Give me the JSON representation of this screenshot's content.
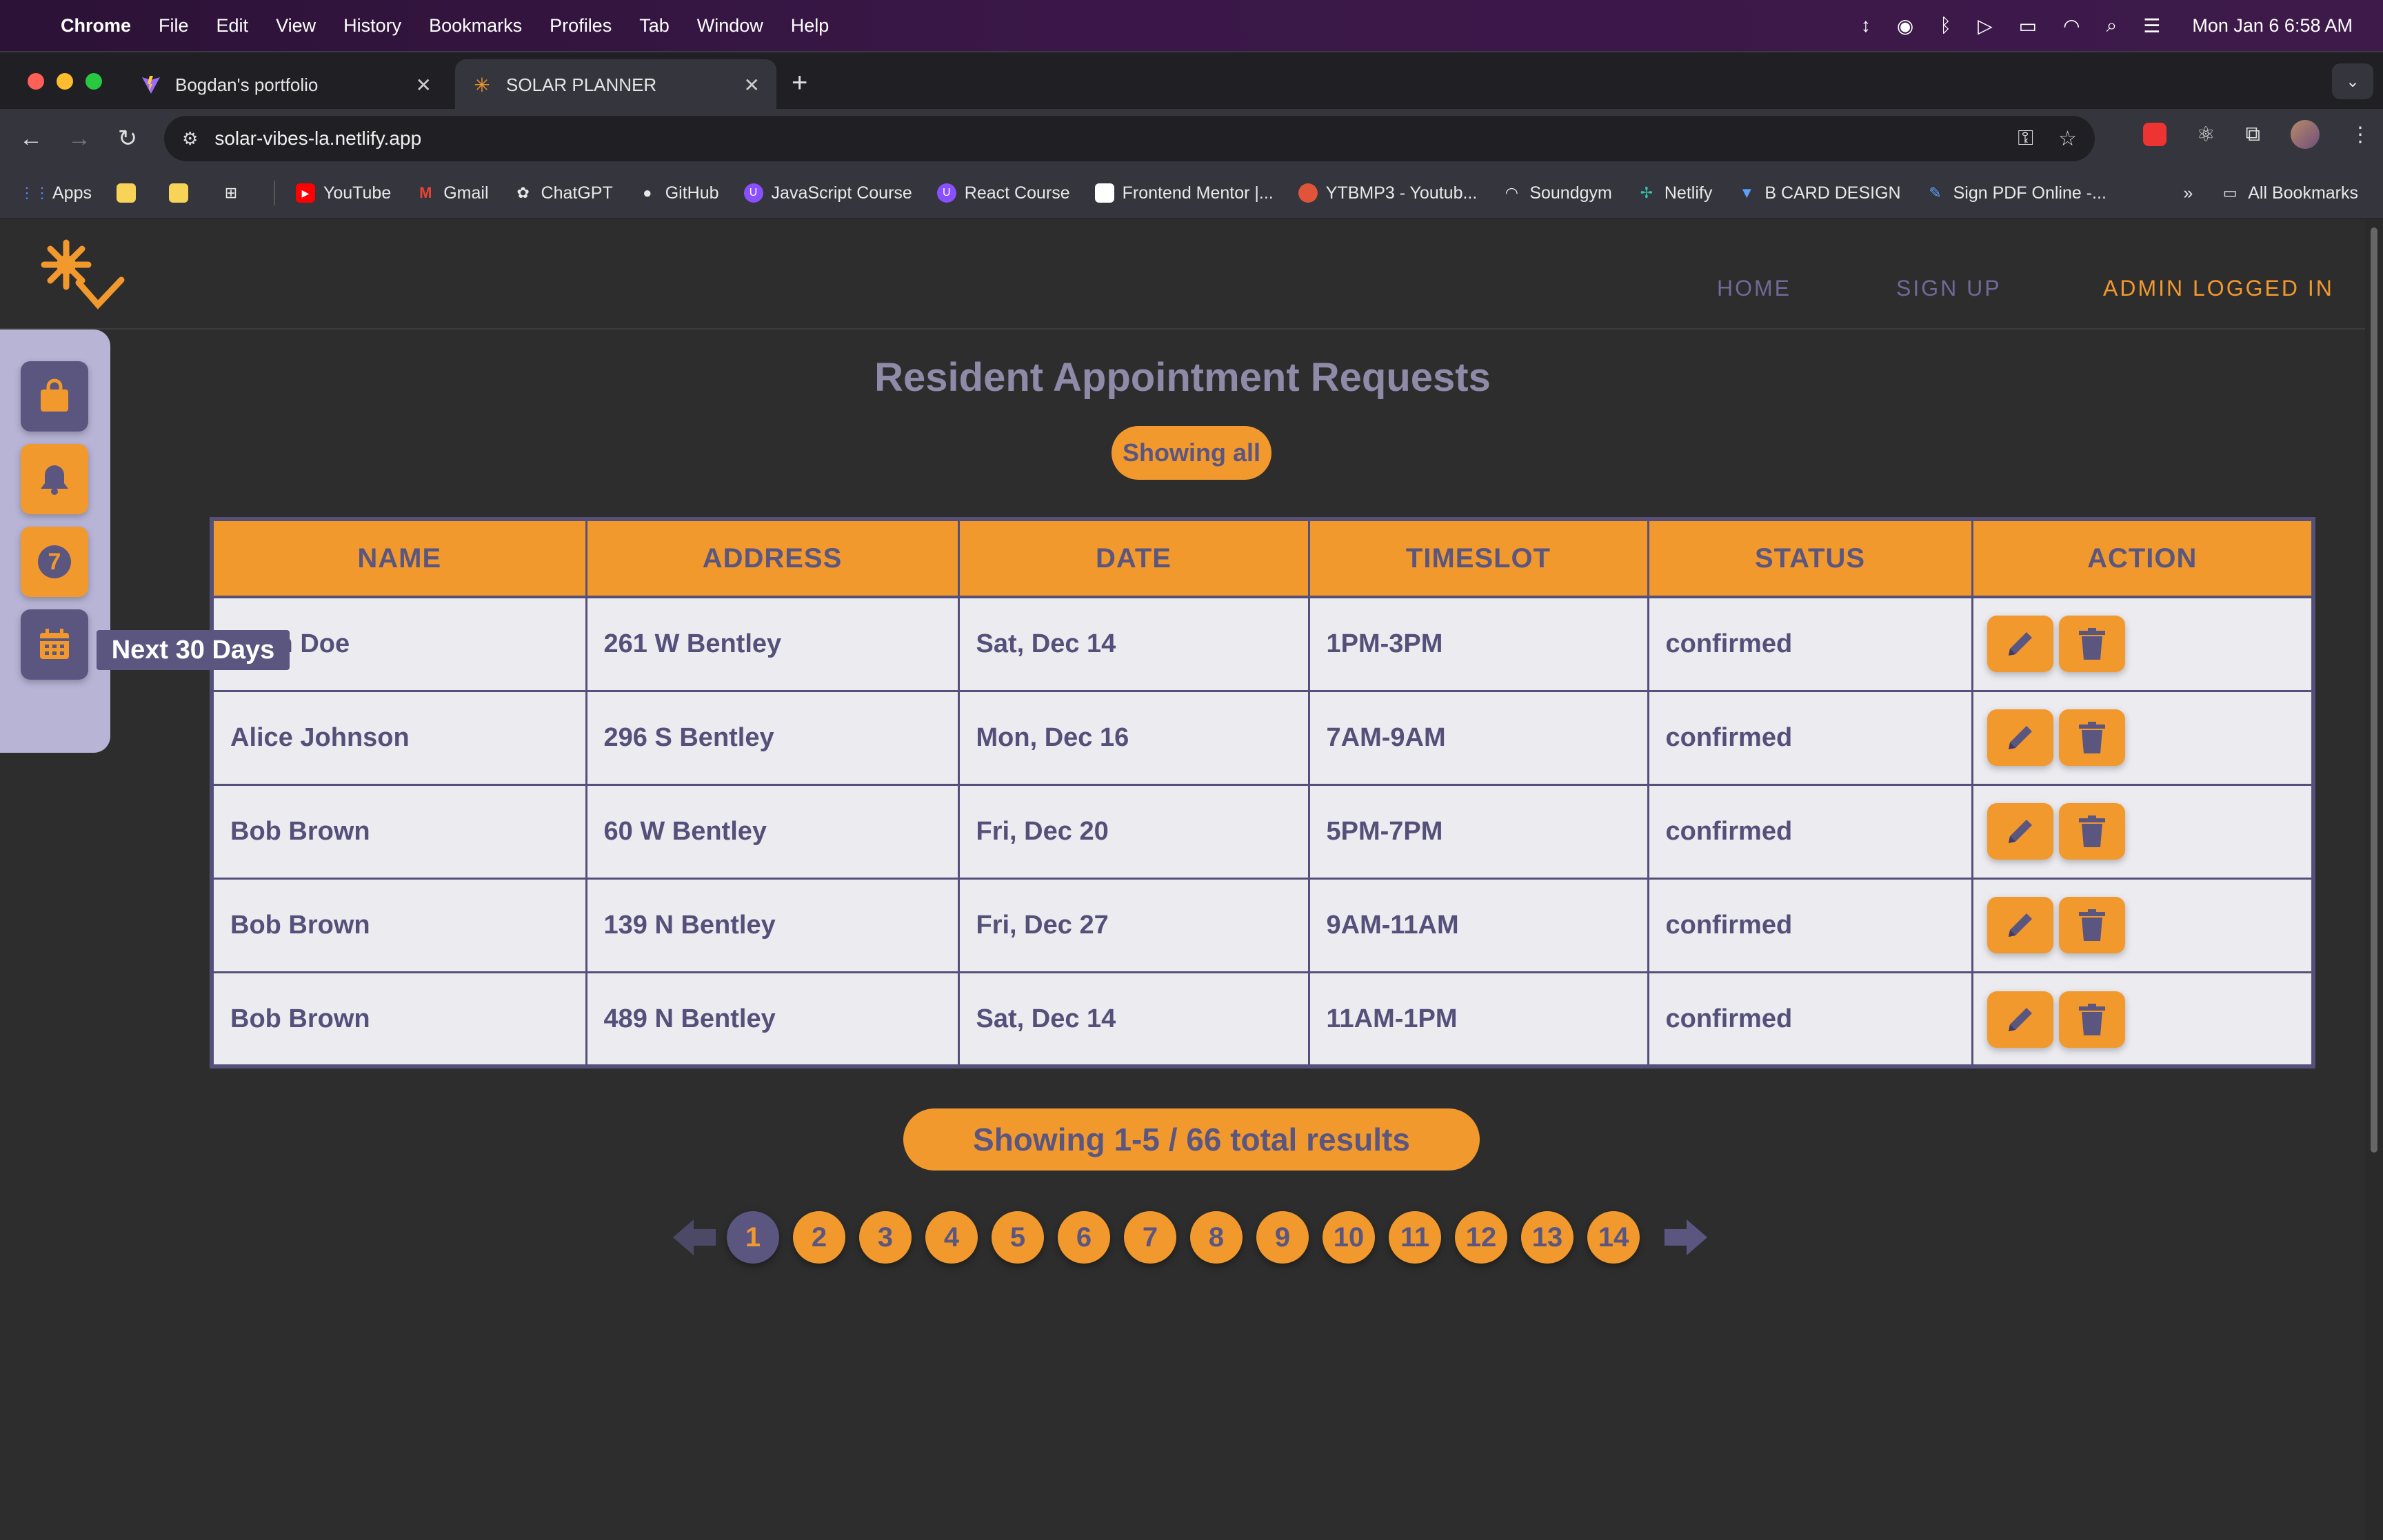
{
  "menubar": {
    "app": "Chrome",
    "items": [
      "File",
      "Edit",
      "View",
      "History",
      "Bookmarks",
      "Profiles",
      "Tab",
      "Window",
      "Help"
    ],
    "clock": "Mon Jan 6  6:58 AM"
  },
  "tabs": [
    {
      "title": "Bogdan's portfolio",
      "icon": "vite-logo-icon",
      "active": false
    },
    {
      "title": "SOLAR PLANNER",
      "icon": "sun-icon",
      "active": true
    }
  ],
  "omnibox": {
    "url": "solar-vibes-la.netlify.app"
  },
  "bookmarks": {
    "apps_label": "Apps",
    "items": [
      "YouTube",
      "Gmail",
      "ChatGPT",
      "GitHub",
      "JavaScript Course",
      "React Course",
      "Frontend Mentor |...",
      "YTBMP3 - Youtub...",
      "Soundgym",
      "Netlify",
      "B CARD DESIGN",
      "Sign PDF Online -..."
    ],
    "all_bookmarks": "All Bookmarks"
  },
  "site": {
    "nav": {
      "home": "HOME",
      "signup": "SIGN UP",
      "admin": "ADMIN LOGGED IN"
    },
    "title": "Resident Appointment Requests",
    "filter_label": "Showing all",
    "tooltip": "Next 30 Days",
    "side_badge": "7",
    "results_label": "Showing 1-5 / 66 total results"
  },
  "table": {
    "headers": [
      "NAME",
      "ADDRESS",
      "DATE",
      "TIMESLOT",
      "STATUS",
      "ACTION"
    ],
    "rows": [
      {
        "name": "John Doe",
        "address": "261 W Bentley",
        "date": "Sat, Dec 14",
        "timeslot": "1PM-3PM",
        "status": "confirmed"
      },
      {
        "name": "Alice Johnson",
        "address": "296 S Bentley",
        "date": "Mon, Dec 16",
        "timeslot": "7AM-9AM",
        "status": "confirmed"
      },
      {
        "name": "Bob Brown",
        "address": "60 W Bentley",
        "date": "Fri, Dec 20",
        "timeslot": "5PM-7PM",
        "status": "confirmed"
      },
      {
        "name": "Bob Brown",
        "address": "139 N Bentley",
        "date": "Fri, Dec 27",
        "timeslot": "9AM-11AM",
        "status": "confirmed"
      },
      {
        "name": "Bob Brown",
        "address": "489 N Bentley",
        "date": "Sat, Dec 14",
        "timeslot": "11AM-1PM",
        "status": "confirmed"
      }
    ]
  },
  "pagination": {
    "pages": [
      "1",
      "2",
      "3",
      "4",
      "5",
      "6",
      "7",
      "8",
      "9",
      "10",
      "11",
      "12",
      "13",
      "14"
    ],
    "current": "1"
  },
  "colors": {
    "accent": "#f2992e",
    "primary": "#5a5680",
    "panel": "#b8b4d6",
    "background": "#2d2d2d"
  }
}
